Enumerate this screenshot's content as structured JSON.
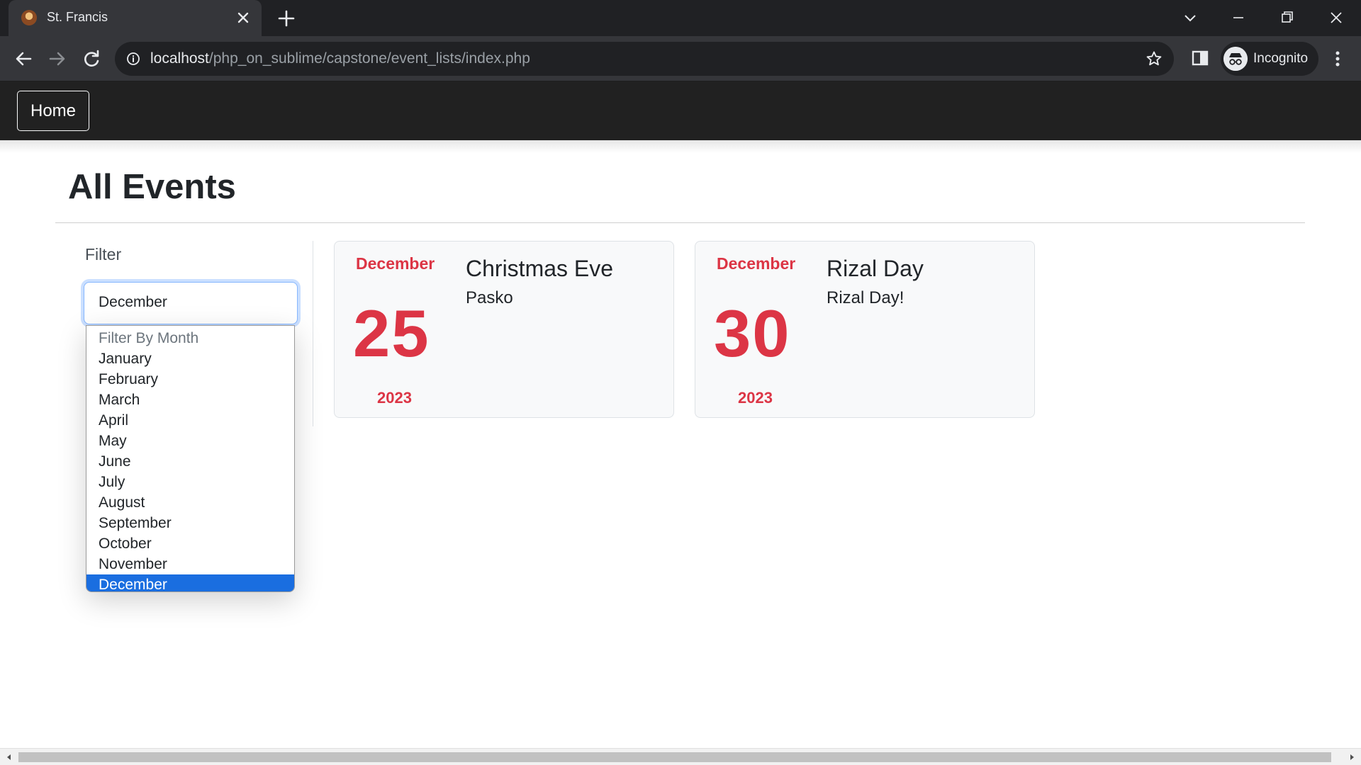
{
  "browser": {
    "tab_title": "St. Francis",
    "url_host": "localhost",
    "url_path": "/php_on_sublime/capstone/event_lists/index.php",
    "profile_label": "Incognito"
  },
  "navbar": {
    "home_label": "Home"
  },
  "page": {
    "title": "All Events"
  },
  "filter": {
    "label": "Filter",
    "selected": "December",
    "options": [
      "Filter By Month",
      "January",
      "February",
      "March",
      "April",
      "May",
      "June",
      "July",
      "August",
      "September",
      "October",
      "November",
      "December"
    ]
  },
  "events": [
    {
      "month": "December",
      "day": "25",
      "year": "2023",
      "title": "Christmas Eve",
      "description": "Pasko"
    },
    {
      "month": "December",
      "day": "30",
      "year": "2023",
      "title": "Rizal Day",
      "description": "Rizal Day!"
    }
  ],
  "colors": {
    "accent_red": "#dc3545",
    "selection_blue": "#1a6ee0",
    "navbar": "#212121"
  }
}
